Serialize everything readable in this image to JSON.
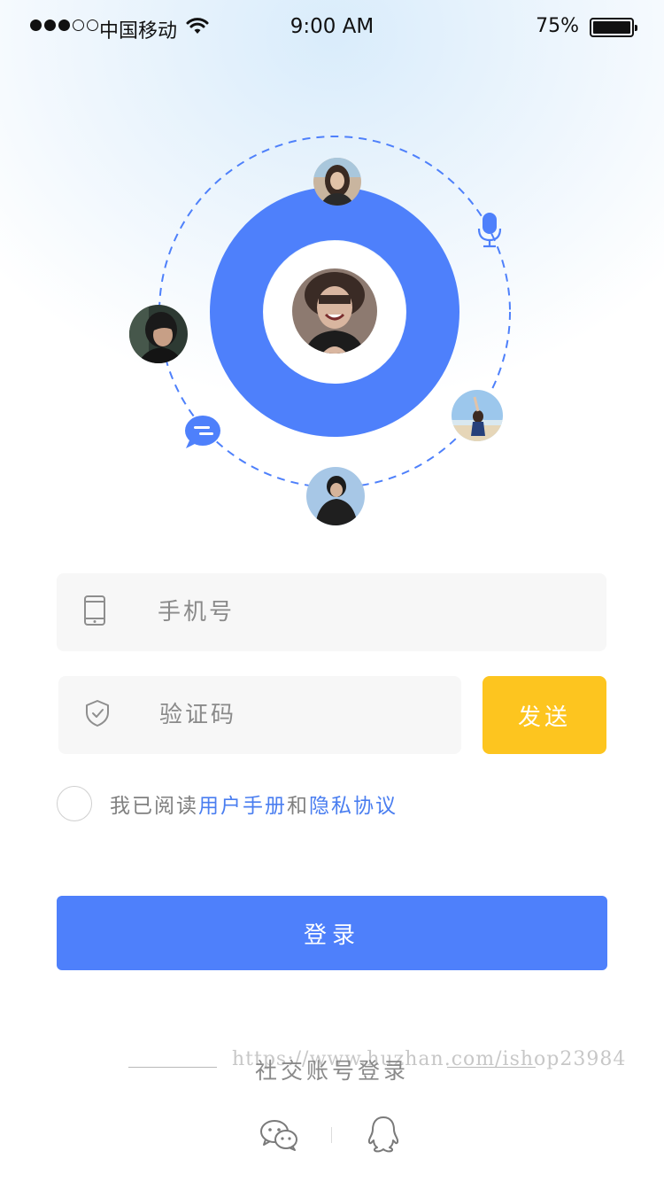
{
  "status_bar": {
    "carrier": "中国移动",
    "time": "9:00 AM",
    "battery_percent": "75%",
    "battery_level": 0.75,
    "signal_filled": 3,
    "signal_total": 5
  },
  "hero": {
    "ring_color": "#4e80fb",
    "orbit_color": "#4e80fb",
    "icons": [
      "microphone-icon",
      "chat-bubble-icon"
    ]
  },
  "form": {
    "phone": {
      "placeholder": "手机号",
      "icon": "phone-icon"
    },
    "code": {
      "placeholder": "验证码",
      "icon": "shield-check-icon"
    },
    "send_label": "发送",
    "send_color": "#fdc51f"
  },
  "agreement": {
    "prefix": "我已阅读",
    "user_manual": "用户手册",
    "conjunction": "和",
    "privacy": "隐私协议",
    "checked": false
  },
  "login": {
    "label": "登录",
    "color": "#4e80fb"
  },
  "social": {
    "title": "社交账号登录",
    "watermark": "https://www.huzhan.com/ishop23984",
    "icons": [
      "wechat-icon",
      "qq-icon"
    ]
  }
}
